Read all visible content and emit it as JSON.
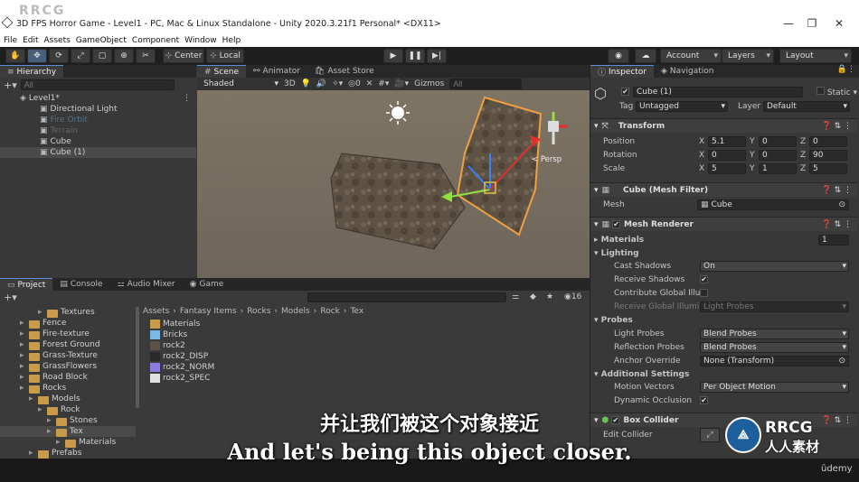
{
  "window": {
    "title": "3D FPS Horror Game - Level1 - PC, Mac & Linux Standalone - Unity 2020.3.21f1 Personal* <DX11>",
    "watermark": "RRCG",
    "controls": [
      "—",
      "❐",
      "✕"
    ]
  },
  "menu": [
    "File",
    "Edit",
    "Assets",
    "GameObject",
    "Component",
    "Window",
    "Help"
  ],
  "toolbar": {
    "pivot": "Center",
    "space": "Local",
    "account": "Account",
    "layers": "Layers",
    "layout": "Layout"
  },
  "hierarchy": {
    "tab": "Hierarchy",
    "search_placeholder": "All",
    "scene": "Level1*",
    "items": [
      {
        "label": "Directional Light",
        "dim": false
      },
      {
        "label": "Fire Orbit",
        "dim": true
      },
      {
        "label": "Terrain",
        "dim": true
      },
      {
        "label": "Cube",
        "dim": false
      },
      {
        "label": "Cube (1)",
        "dim": false
      }
    ]
  },
  "scene": {
    "tabs": [
      "Scene",
      "Animator",
      "Asset Store"
    ],
    "shading": "Shaded",
    "mode": "3D",
    "gizmos": "Gizmos",
    "search_placeholder": "All",
    "persp": "< Persp"
  },
  "bottom": {
    "tabs": [
      "Project",
      "Console",
      "Audio Mixer",
      "Game"
    ],
    "breadcrumb": [
      "Assets",
      "Fantasy Items",
      "Rocks",
      "Models",
      "Rock",
      "Tex"
    ],
    "count": "16",
    "tree": [
      {
        "label": "Textures",
        "indent": 3
      },
      {
        "label": "Fence",
        "indent": 1
      },
      {
        "label": "Fire-texture",
        "indent": 1
      },
      {
        "label": "Forest Ground",
        "indent": 1
      },
      {
        "label": "Grass-Texture",
        "indent": 1
      },
      {
        "label": "GrassFlowers",
        "indent": 1
      },
      {
        "label": "Road Block",
        "indent": 1
      },
      {
        "label": "Rocks",
        "indent": 1
      },
      {
        "label": "Models",
        "indent": 2
      },
      {
        "label": "Rock",
        "indent": 3
      },
      {
        "label": "Stones",
        "indent": 4
      },
      {
        "label": "Tex",
        "indent": 4
      },
      {
        "label": "Materials",
        "indent": 5
      },
      {
        "label": "Prefabs",
        "indent": 2
      }
    ],
    "files": [
      {
        "label": "Materials",
        "color": "#c79b4a"
      },
      {
        "label": "Bricks",
        "color": "#7ab8e8"
      },
      {
        "label": "rock2",
        "color": "#5a5248"
      },
      {
        "label": "rock2_DISP",
        "color": "#2a2a2a"
      },
      {
        "label": "rock2_NORM",
        "color": "#8a7ce0"
      },
      {
        "label": "rock2_SPEC",
        "color": "#e0e0e0"
      }
    ]
  },
  "inspector": {
    "tabs": [
      "Inspector",
      "Navigation"
    ],
    "object_name": "Cube (1)",
    "static": "Static",
    "tag_label": "Tag",
    "tag": "Untagged",
    "layer_label": "Layer",
    "layer": "Default",
    "transform": {
      "title": "Transform",
      "rows": [
        {
          "label": "Position",
          "x": "5.1",
          "y": "0",
          "z": "0"
        },
        {
          "label": "Rotation",
          "x": "0",
          "y": "0",
          "z": "90"
        },
        {
          "label": "Scale",
          "x": "5",
          "y": "1",
          "z": "5"
        }
      ]
    },
    "mesh_filter": {
      "title": "Cube (Mesh Filter)",
      "mesh_label": "Mesh",
      "mesh": "Cube"
    },
    "mesh_renderer": {
      "title": "Mesh Renderer",
      "materials": "Materials",
      "materials_count": "1",
      "lighting": "Lighting",
      "cast_shadows_label": "Cast Shadows",
      "cast_shadows": "On",
      "receive_shadows": "Receive Shadows",
      "contribute_gi": "Contribute Global Illui",
      "receive_gi": "Receive Global Illumi",
      "receive_gi_value": "Light Probes",
      "probes": "Probes",
      "light_probes_label": "Light Probes",
      "light_probes": "Blend Probes",
      "reflection_probes_label": "Reflection Probes",
      "reflection_probes": "Blend Probes",
      "anchor_override_label": "Anchor Override",
      "anchor_override": "None (Transform)",
      "additional": "Additional Settings",
      "motion_vectors_label": "Motion Vectors",
      "motion_vectors": "Per Object Motion",
      "dynamic_occlusion": "Dynamic Occlusion"
    },
    "box_collider": {
      "title": "Box Collider",
      "edit_collider": "Edit Collider"
    }
  },
  "subtitles": {
    "zh": "并让我们被这个对象接近",
    "en": "And let's being this object closer."
  },
  "branding": {
    "rrcg": "RRCG",
    "rrcg_cn": "人人素材",
    "udemy": "ūdemy"
  },
  "colors": {
    "accent": "#5a8ed6",
    "selection": "#2c5d87",
    "play_bg": "#3c3c3c"
  }
}
